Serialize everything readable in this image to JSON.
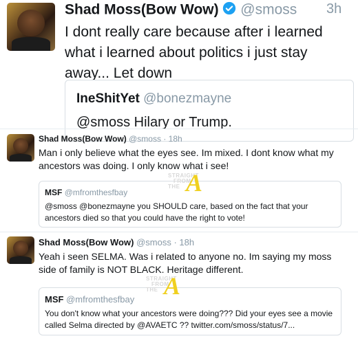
{
  "tweet1": {
    "name": "Shad Moss(Bow Wow)",
    "handle": "@smoss",
    "time": "3h",
    "text": "I dont really care because after i learned what i learned about politics i just stay away... Let down",
    "quote": {
      "name": "IneShitYet",
      "handle": "@bonezmayne",
      "text": "@smoss Hilary or Trump."
    }
  },
  "tweet2": {
    "name": "Shad Moss(Bow Wow)",
    "handle": "@smoss",
    "time": "· 18h",
    "text": "Man i only believe what the eyes see. Im mixed. I dont know what my ancestors was doing. I only know what i see!",
    "quote": {
      "name": "MSF",
      "handle": "@mfromthesfbay",
      "text": "@smoss @bonezmayne you SHOULD care, based on the fact that your ancestors died so that you could have the right to vote!"
    }
  },
  "tweet3": {
    "name": "Shad Moss(Bow Wow)",
    "handle": "@smoss",
    "time": "· 18h",
    "text": "Yeah i seen SELMA. Was i related to anyone no. Im saying my moss side of family is NOT BLACK. Heritage different.",
    "quote": {
      "name": "MSF",
      "handle": "@mfromthesfbay",
      "text": "You don't know what your ancestors were doing??? Did your eyes see a movie called Selma directed by @AVAETC ?? twitter.com/smoss/status/7..."
    }
  },
  "watermark": {
    "line1": "STRAIGHT",
    "line2": "FROM",
    "line3": "THE",
    "letter": "A"
  },
  "colors": {
    "verified": "#1da1f2",
    "watermark_letter": "#f0d020"
  },
  "icons": {
    "verified": "verified-badge-icon"
  }
}
